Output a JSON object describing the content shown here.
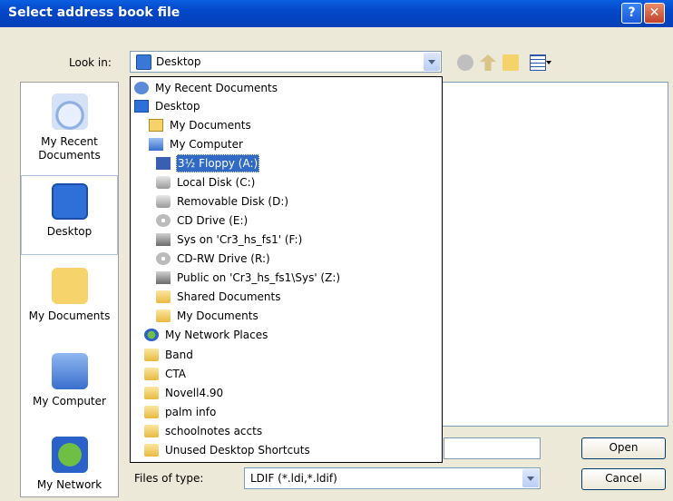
{
  "window": {
    "title": "Select address book file",
    "help_label": "?",
    "close_label": "✕"
  },
  "look_in": {
    "label": "Look in:",
    "value": "Desktop"
  },
  "toolbar": {
    "icons": [
      "back-icon",
      "up-folder-icon",
      "new-folder-icon",
      "views-menu-icon"
    ]
  },
  "places_bar": [
    {
      "label": "My Recent Documents",
      "icon": "recent-documents-icon"
    },
    {
      "label": "Desktop",
      "icon": "desktop-icon",
      "selected": true
    },
    {
      "label": "My Documents",
      "icon": "my-documents-icon"
    },
    {
      "label": "My Computer",
      "icon": "my-computer-icon"
    },
    {
      "label": "My Network",
      "icon": "my-network-icon"
    }
  ],
  "look_in_dropdown": {
    "items": [
      {
        "label": "My Recent Documents",
        "icon": "recent-documents-icon",
        "level": 0
      },
      {
        "label": "Desktop",
        "icon": "desktop-icon",
        "level": 0
      },
      {
        "label": "My Documents",
        "icon": "my-documents-icon",
        "level": 1
      },
      {
        "label": "My Computer",
        "icon": "my-computer-icon",
        "level": 1
      },
      {
        "label": "3½ Floppy (A:)",
        "icon": "floppy-drive-icon",
        "level": 2,
        "selected": true
      },
      {
        "label": "Local Disk (C:)",
        "icon": "hard-disk-icon",
        "level": 2
      },
      {
        "label": "Removable Disk (D:)",
        "icon": "removable-disk-icon",
        "level": 2
      },
      {
        "label": "CD Drive (E:)",
        "icon": "cd-drive-icon",
        "level": 2
      },
      {
        "label": "Sys on 'Cr3_hs_fs1' (F:)",
        "icon": "network-drive-icon",
        "level": 2
      },
      {
        "label": "CD-RW Drive (R:)",
        "icon": "cd-drive-icon",
        "level": 2
      },
      {
        "label": "Public on 'Cr3_hs_fs1\\Sys' (Z:)",
        "icon": "network-drive-icon",
        "level": 2
      },
      {
        "label": "Shared Documents",
        "icon": "folder-icon",
        "level": 2
      },
      {
        "label": "My Documents",
        "icon": "folder-icon",
        "level": 2
      },
      {
        "label": "My Network Places",
        "icon": "network-places-icon",
        "level": 1
      },
      {
        "label": "Band",
        "icon": "folder-icon",
        "level": 1
      },
      {
        "label": "CTA",
        "icon": "folder-icon",
        "level": 1
      },
      {
        "label": "Novell4.90",
        "icon": "folder-icon",
        "level": 1
      },
      {
        "label": "palm info",
        "icon": "folder-icon",
        "level": 1
      },
      {
        "label": "schoolnotes accts",
        "icon": "folder-icon",
        "level": 1
      },
      {
        "label": "Unused Desktop Shortcuts",
        "icon": "folder-icon",
        "level": 1
      }
    ]
  },
  "file_name": {
    "value": ""
  },
  "file_type": {
    "label": "Files of type:",
    "value": "LDIF (*.ldi,*.ldif)"
  },
  "buttons": {
    "open_label": "Open",
    "cancel_label": "Cancel"
  },
  "colors": {
    "titlebar": "#0a5fe0",
    "selection": "#316ac5",
    "dialog_bg": "#ece9d8"
  }
}
